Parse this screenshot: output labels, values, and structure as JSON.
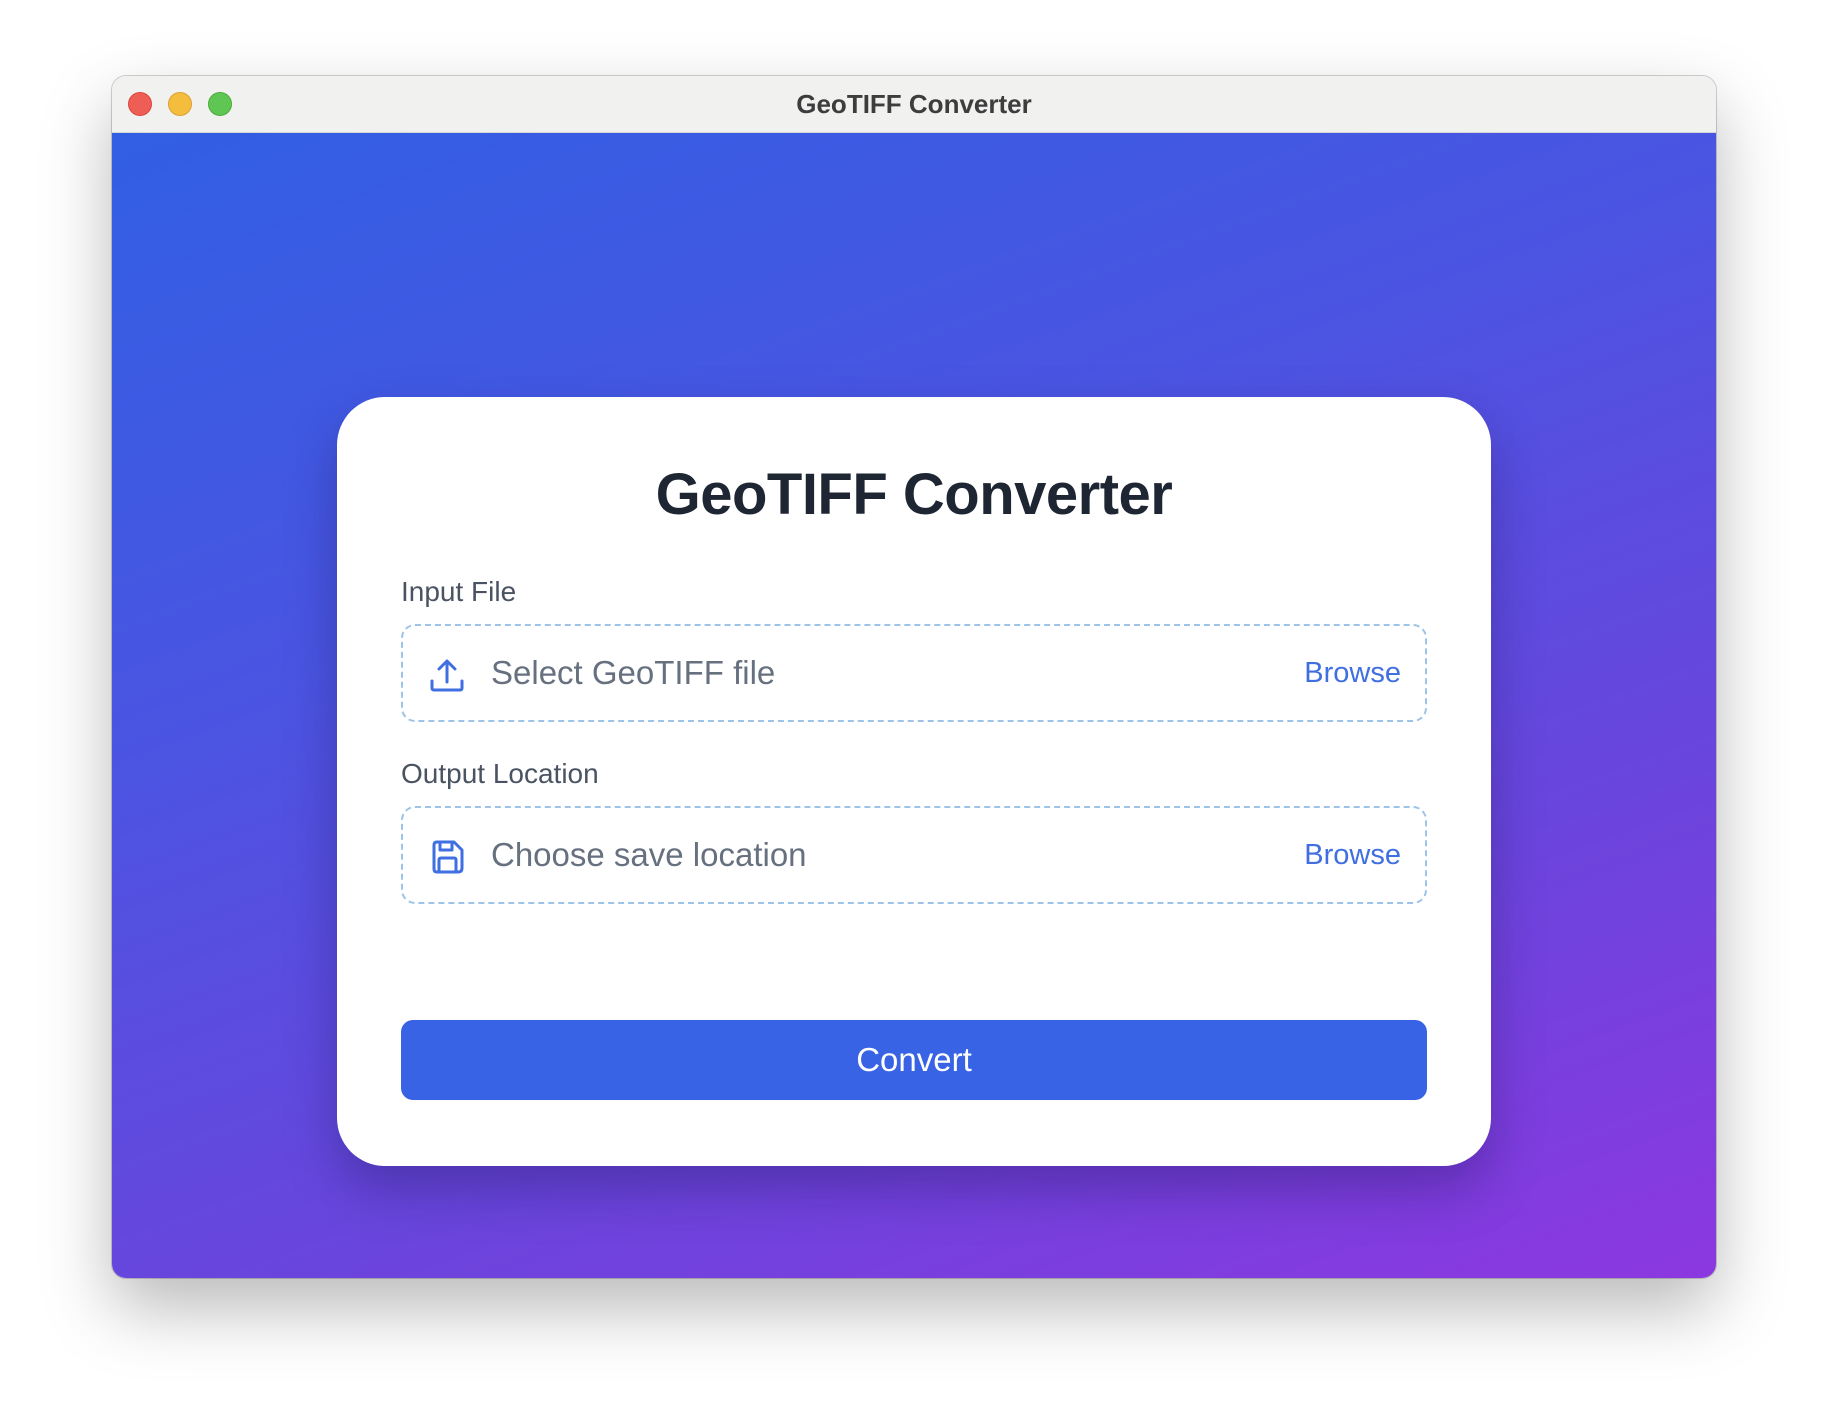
{
  "window": {
    "title": "GeoTIFF Converter"
  },
  "card": {
    "title": "GeoTIFF Converter"
  },
  "input_file": {
    "label": "Input File",
    "placeholder": "Select GeoTIFF file",
    "browse_label": "Browse",
    "icon": "upload-icon"
  },
  "output_location": {
    "label": "Output Location",
    "placeholder": "Choose save location",
    "browse_label": "Browse",
    "icon": "save-icon"
  },
  "convert_button": {
    "label": "Convert"
  },
  "colors": {
    "accent": "#3863e4",
    "link": "#3f6fe0",
    "gradient_start": "#315fe3",
    "gradient_end": "#8c38e0",
    "dashed_border": "#9ec3e8"
  }
}
